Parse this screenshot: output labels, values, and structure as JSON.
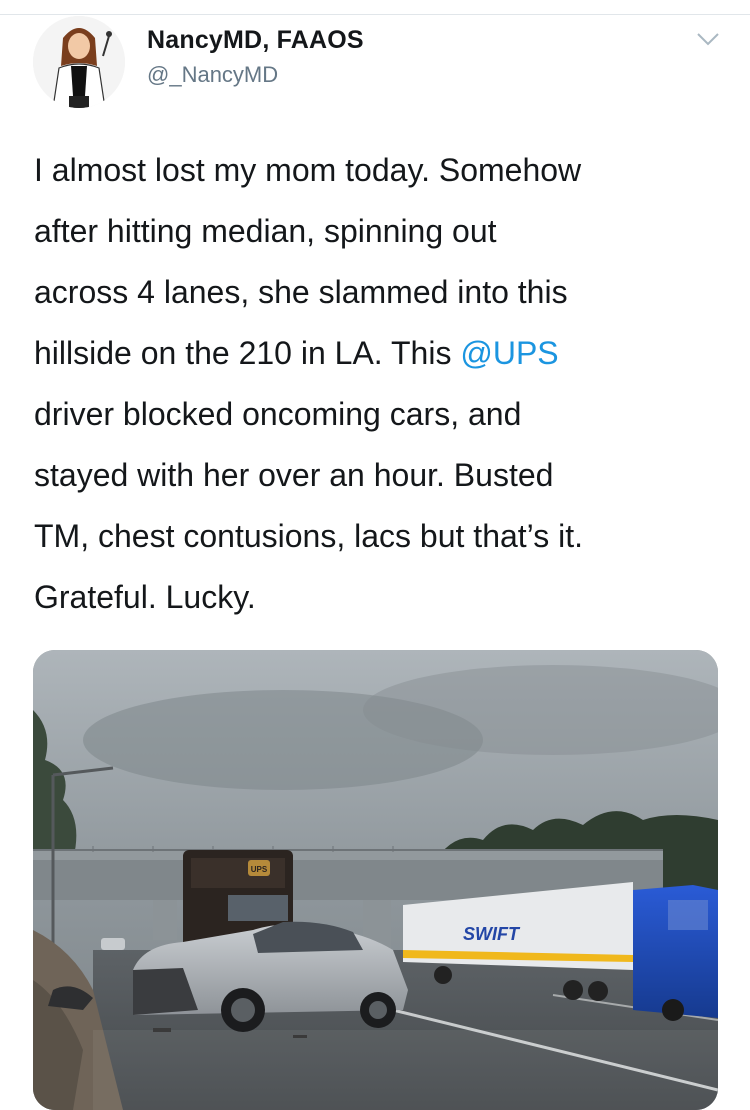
{
  "tweet": {
    "display_name": "NancyMD, FAAOS",
    "handle": "@_NancyMD",
    "text_before": "I almost lost my mom today. Somehow\nafter hitting median, spinning out\nacross 4 lanes, she slammed into this\nhillside on the 210 in LA. This ",
    "mention": "@UPS",
    "text_after": "\ndriver blocked oncoming cars, and\nstayed with her over an hour. Busted\nTM, chest contusions, lacs but that’s it.\nGrateful. Lucky.",
    "media": {
      "truck_logo_text": "UPS",
      "trailer_text": "SWIFT"
    }
  },
  "icons": {
    "more": "chevron-down-icon",
    "avatar": "avatar"
  },
  "colors": {
    "text": "#14171a",
    "secondary": "#657786",
    "link": "#1b95e0"
  }
}
